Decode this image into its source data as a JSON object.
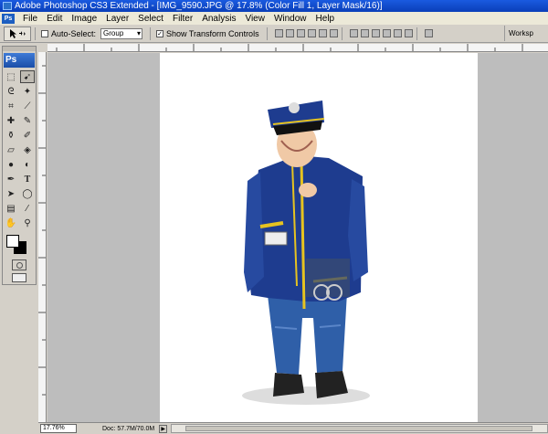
{
  "window": {
    "title": "Adobe Photoshop CS3 Extended - [IMG_9590.JPG @ 17.8% (Color Fill 1, Layer Mask/16)]"
  },
  "menu": {
    "logo": "Ps",
    "items": [
      "File",
      "Edit",
      "Image",
      "Layer",
      "Select",
      "Filter",
      "Analysis",
      "View",
      "Window",
      "Help"
    ]
  },
  "options": {
    "auto_select_label": "Auto-Select:",
    "auto_select_checked": false,
    "auto_select_value": "Group",
    "show_transform_label": "Show Transform Controls",
    "show_transform_checked": true,
    "workspace_label": "Worksp"
  },
  "tools": {
    "badge": "Ps",
    "items": [
      "marquee-icon",
      "move-icon",
      "lasso-icon",
      "magic-wand-icon",
      "crop-icon",
      "slice-icon",
      "healing-brush-icon",
      "brush-icon",
      "clone-stamp-icon",
      "history-brush-icon",
      "eraser-icon",
      "paint-bucket-icon",
      "blur-icon",
      "dodge-icon",
      "pen-icon",
      "type-icon",
      "path-selection-icon",
      "shape-icon",
      "notes-icon",
      "eyedropper-icon",
      "hand-icon",
      "zoom-icon"
    ],
    "foreground_color": "#ffffff",
    "background_color": "#000000"
  },
  "status": {
    "zoom": "17.76%",
    "doc_info": "Doc: 57.7M/70.0M"
  }
}
